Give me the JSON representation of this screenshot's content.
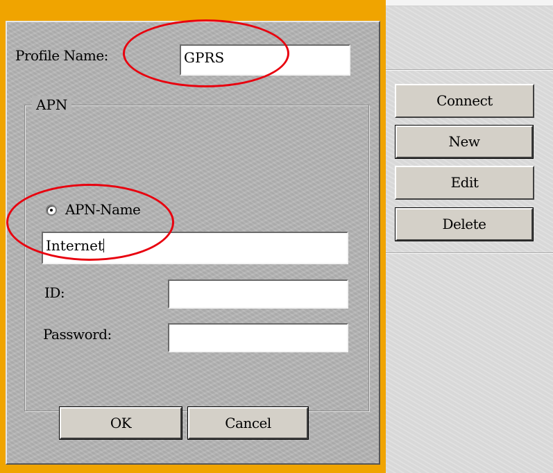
{
  "dialog": {
    "profile_name_label": "Profile Name:",
    "profile_name_value": "GPRS",
    "apn_group_label": "APN",
    "apn_radio_label": "APN-Name",
    "apn_name_value": "Internet",
    "id_label": "ID:",
    "id_value": "",
    "password_label": "Password:",
    "password_value": "",
    "ok_label": "OK",
    "cancel_label": "Cancel"
  },
  "side_panel": {
    "buttons": [
      {
        "label": "Connect"
      },
      {
        "label": "New"
      },
      {
        "label": "Edit"
      },
      {
        "label": "Delete"
      }
    ]
  },
  "annotations": {
    "highlight_color": "#e8000e"
  },
  "colors": {
    "frame_accent": "#f0a400",
    "dialog_bg": "#b5b5b5",
    "panel_bg": "#dcdcdc",
    "button_face": "#d4d0c8"
  }
}
